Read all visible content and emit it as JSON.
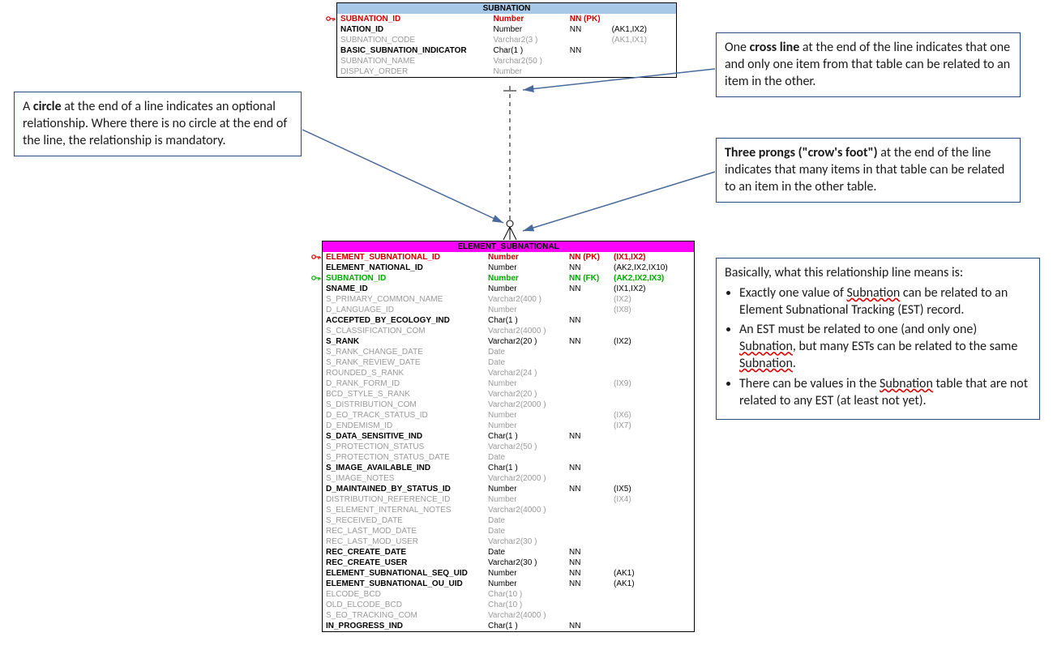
{
  "entities": {
    "subnation": {
      "title": "SUBNATION",
      "rows": [
        {
          "name": "SUBNATION_ID",
          "type": "Number",
          "nn": "NN (PK)",
          "idx": "",
          "style": "red",
          "key": "red"
        },
        {
          "name": "NATION_ID",
          "type": "Number",
          "nn": "NN",
          "idx": "(AK1,IX2)",
          "style": "bold"
        },
        {
          "name": "SUBNATION_CODE",
          "type": "Varchar2(3 )",
          "nn": "",
          "idx": "(AK1,IX1)",
          "style": "faint"
        },
        {
          "name": "BASIC_SUBNATION_INDICATOR",
          "type": "Char(1 )",
          "nn": "NN",
          "idx": "",
          "style": "bold"
        },
        {
          "name": "SUBNATION_NAME",
          "type": "Varchar2(50 )",
          "nn": "",
          "idx": "",
          "style": "faint"
        },
        {
          "name": "DISPLAY_ORDER",
          "type": "Number",
          "nn": "",
          "idx": "",
          "style": "faint"
        }
      ]
    },
    "element_subnational": {
      "title": "ELEMENT_SUBNATIONAL",
      "rows": [
        {
          "name": "ELEMENT_SUBNATIONAL_ID",
          "type": "Number",
          "nn": "NN (PK)",
          "idx": "(IX1,IX2)",
          "style": "red",
          "key": "red"
        },
        {
          "name": "ELEMENT_NATIONAL_ID",
          "type": "Number",
          "nn": "NN",
          "idx": "(AK2,IX2,IX10)",
          "style": "bold"
        },
        {
          "name": "SUBNATION_ID",
          "type": "Number",
          "nn": "NN (FK)",
          "idx": "(AK2,IX2,IX3)",
          "style": "green",
          "key": "green"
        },
        {
          "name": "SNAME_ID",
          "type": "Number",
          "nn": "NN",
          "idx": "(IX1,IX2)",
          "style": "bold"
        },
        {
          "name": "S_PRIMARY_COMMON_NAME",
          "type": "Varchar2(400 )",
          "nn": "",
          "idx": "(IX2)",
          "style": "faint"
        },
        {
          "name": "D_LANGUAGE_ID",
          "type": "Number",
          "nn": "",
          "idx": "(IX8)",
          "style": "faint"
        },
        {
          "name": "ACCEPTED_BY_ECOLOGY_IND",
          "type": "Char(1 )",
          "nn": "NN",
          "idx": "",
          "style": "bold"
        },
        {
          "name": "S_CLASSIFICATION_COM",
          "type": "Varchar2(4000 )",
          "nn": "",
          "idx": "",
          "style": "faint"
        },
        {
          "name": "S_RANK",
          "type": "Varchar2(20 )",
          "nn": "NN",
          "idx": "(IX2)",
          "style": "bold"
        },
        {
          "name": "S_RANK_CHANGE_DATE",
          "type": "Date",
          "nn": "",
          "idx": "",
          "style": "faint"
        },
        {
          "name": "S_RANK_REVIEW_DATE",
          "type": "Date",
          "nn": "",
          "idx": "",
          "style": "faint"
        },
        {
          "name": "ROUNDED_S_RANK",
          "type": "Varchar2(24 )",
          "nn": "",
          "idx": "",
          "style": "faint"
        },
        {
          "name": "D_RANK_FORM_ID",
          "type": "Number",
          "nn": "",
          "idx": "(IX9)",
          "style": "faint"
        },
        {
          "name": "BCD_STYLE_S_RANK",
          "type": "Varchar2(20 )",
          "nn": "",
          "idx": "",
          "style": "faint"
        },
        {
          "name": "S_DISTRIBUTION_COM",
          "type": "Varchar2(2000 )",
          "nn": "",
          "idx": "",
          "style": "faint"
        },
        {
          "name": "D_EO_TRACK_STATUS_ID",
          "type": "Number",
          "nn": "",
          "idx": "(IX6)",
          "style": "faint"
        },
        {
          "name": "D_ENDEMISM_ID",
          "type": "Number",
          "nn": "",
          "idx": "(IX7)",
          "style": "faint"
        },
        {
          "name": "S_DATA_SENSITIVE_IND",
          "type": "Char(1 )",
          "nn": "NN",
          "idx": "",
          "style": "bold"
        },
        {
          "name": "S_PROTECTION_STATUS",
          "type": "Varchar2(50 )",
          "nn": "",
          "idx": "",
          "style": "faint"
        },
        {
          "name": "S_PROTECTION_STATUS_DATE",
          "type": "Date",
          "nn": "",
          "idx": "",
          "style": "faint"
        },
        {
          "name": "S_IMAGE_AVAILABLE_IND",
          "type": "Char(1 )",
          "nn": "NN",
          "idx": "",
          "style": "bold"
        },
        {
          "name": "S_IMAGE_NOTES",
          "type": "Varchar2(2000 )",
          "nn": "",
          "idx": "",
          "style": "faint"
        },
        {
          "name": "D_MAINTAINED_BY_STATUS_ID",
          "type": "Number",
          "nn": "NN",
          "idx": "(IX5)",
          "style": "bold"
        },
        {
          "name": "DISTRIBUTION_REFERENCE_ID",
          "type": "Number",
          "nn": "",
          "idx": "(IX4)",
          "style": "faint"
        },
        {
          "name": "S_ELEMENT_INTERNAL_NOTES",
          "type": "Varchar2(4000 )",
          "nn": "",
          "idx": "",
          "style": "faint"
        },
        {
          "name": "S_RECEIVED_DATE",
          "type": "Date",
          "nn": "",
          "idx": "",
          "style": "faint"
        },
        {
          "name": "REC_LAST_MOD_DATE",
          "type": "Date",
          "nn": "",
          "idx": "",
          "style": "faint"
        },
        {
          "name": "REC_LAST_MOD_USER",
          "type": "Varchar2(30 )",
          "nn": "",
          "idx": "",
          "style": "faint"
        },
        {
          "name": "REC_CREATE_DATE",
          "type": "Date",
          "nn": "NN",
          "idx": "",
          "style": "bold"
        },
        {
          "name": "REC_CREATE_USER",
          "type": "Varchar2(30 )",
          "nn": "NN",
          "idx": "",
          "style": "bold"
        },
        {
          "name": "ELEMENT_SUBNATIONAL_SEQ_UID",
          "type": "Number",
          "nn": "NN",
          "idx": "(AK1)",
          "style": "bold"
        },
        {
          "name": "ELEMENT_SUBNATIONAL_OU_UID",
          "type": "Number",
          "nn": "NN",
          "idx": "(AK1)",
          "style": "bold"
        },
        {
          "name": "ELCODE_BCD",
          "type": "Char(10 )",
          "nn": "",
          "idx": "",
          "style": "faint"
        },
        {
          "name": "OLD_ELCODE_BCD",
          "type": "Char(10 )",
          "nn": "",
          "idx": "",
          "style": "faint"
        },
        {
          "name": "S_EO_TRACKING_COM",
          "type": "Varchar2(4000 )",
          "nn": "",
          "idx": "",
          "style": "faint"
        },
        {
          "name": "IN_PROGRESS_IND",
          "type": "Char(1 )",
          "nn": "NN",
          "idx": "",
          "style": "bold"
        }
      ]
    }
  },
  "callouts": {
    "circle": {
      "pre": "A ",
      "bold": "circle",
      "rest": " at the end of a line indicates an optional relationship. Where there is no circle at the end of the line, the relationship is mandatory."
    },
    "cross": {
      "pre": "One ",
      "bold": "cross line",
      "rest": " at the end of the line indicates that one and only one item from that table can be related to an item in the other."
    },
    "crowsfoot": {
      "bold": "Three prongs (\"crow's foot\")",
      "rest": " at the end of the line indicates that many items in that table can be related to an item in the other table."
    },
    "summary": {
      "intro": "Basically, what this relationship line means is:",
      "b1a": "Exactly one value of ",
      "b1s": "Subnation",
      "b1b": " can be related to an Element Subnational Tracking (EST) record.",
      "b2a": "An EST must be related to one (and only one) ",
      "b2s1": "Subnation",
      "b2b": ", but many ESTs can be related to the same ",
      "b2s2": "Subnation",
      "b2c": ".",
      "b3a": "There can be values in the ",
      "b3s": "Subnation",
      "b3b": " table that are not related to any EST (at least not yet)."
    }
  }
}
